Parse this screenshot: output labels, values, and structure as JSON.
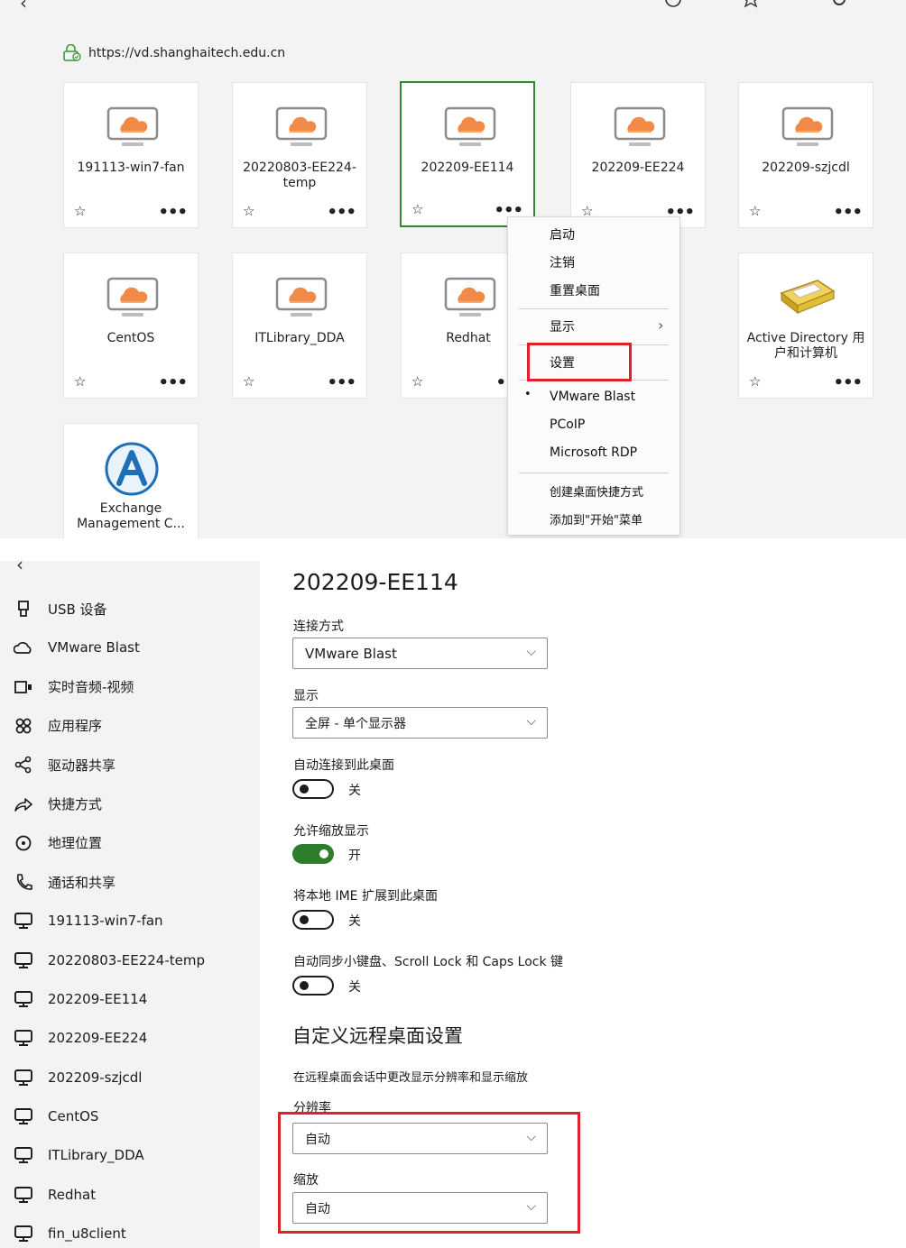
{
  "top": {
    "url": "https://vd.shanghaitech.edu.cn",
    "back_glyph": "‹",
    "topbar_icons": [
      "clock-icon",
      "star-icon",
      "gear-icon"
    ],
    "tiles": [
      {
        "name": "191113-win7-fan",
        "icon": "desktop-cloud-icon"
      },
      {
        "name": "20220803-EE224-temp",
        "icon": "desktop-cloud-icon"
      },
      {
        "name": "202209-EE114",
        "icon": "desktop-cloud-icon",
        "selected": true
      },
      {
        "name": "202209-EE224",
        "icon": "desktop-cloud-icon"
      },
      {
        "name": "202209-szjcdl",
        "icon": "desktop-cloud-icon"
      },
      {
        "name": "CentOS",
        "icon": "desktop-cloud-icon"
      },
      {
        "name": "ITLibrary_DDA",
        "icon": "desktop-cloud-icon"
      },
      {
        "name": "Redhat",
        "icon": "desktop-cloud-icon"
      },
      {
        "name": "Active Directory 用户和计算机",
        "icon": "address-book-icon"
      },
      {
        "name": "Exchange Management C...",
        "icon": "exchange-icon"
      }
    ],
    "context_menu": {
      "items_a": [
        "启动",
        "注销",
        "重置桌面"
      ],
      "display": "显示",
      "settings": "设置",
      "protocols": [
        "VMware Blast",
        "PCoIP",
        "Microsoft RDP"
      ],
      "selected_protocol": "VMware Blast",
      "items_b": [
        "创建桌面快捷方式",
        "添加到\"开始\"菜单"
      ]
    },
    "accent": "#2f8a2f",
    "highlight": "#e0202b"
  },
  "sidebar": {
    "back_glyph": "‹",
    "items": [
      {
        "label": "USB 设备",
        "icon": "usb-icon"
      },
      {
        "label": "VMware Blast",
        "icon": "cloud-icon"
      },
      {
        "label": "实时音频-视频",
        "icon": "webcam-icon"
      },
      {
        "label": "应用程序",
        "icon": "apps-icon"
      },
      {
        "label": "驱动器共享",
        "icon": "share-icon"
      },
      {
        "label": "快捷方式",
        "icon": "shortcut-icon"
      },
      {
        "label": "地理位置",
        "icon": "location-icon"
      },
      {
        "label": "通话和共享",
        "icon": "phone-icon"
      },
      {
        "label": "191113-win7-fan",
        "icon": "desktop-icon"
      },
      {
        "label": "20220803-EE224-temp",
        "icon": "desktop-icon"
      },
      {
        "label": "202209-EE114",
        "icon": "desktop-icon"
      },
      {
        "label": "202209-EE224",
        "icon": "desktop-icon"
      },
      {
        "label": "202209-szjcdl",
        "icon": "desktop-icon"
      },
      {
        "label": "CentOS",
        "icon": "desktop-icon"
      },
      {
        "label": "ITLibrary_DDA",
        "icon": "desktop-icon"
      },
      {
        "label": "Redhat",
        "icon": "desktop-icon"
      },
      {
        "label": "fin_u8client",
        "icon": "desktop-icon"
      }
    ]
  },
  "settings": {
    "title": "202209-EE114",
    "connection_label": "连接方式",
    "connection_value": "VMware Blast",
    "display_label": "显示",
    "display_value": "全屏 - 单个显示器",
    "auto_connect_label": "自动连接到此桌面",
    "auto_connect_state": "关",
    "allow_scaling_label": "允许缩放显示",
    "allow_scaling_state": "开",
    "ime_label": "将本地 IME 扩展到此桌面",
    "ime_state": "关",
    "sync_label": "自动同步小键盘、Scroll Lock 和 Caps Lock 键",
    "sync_state": "关",
    "custom_heading": "自定义远程桌面设置",
    "custom_desc": "在远程桌面会话中更改显示分辨率和显示缩放",
    "resolution_label": "分辨率",
    "resolution_value": "自动",
    "scale_label": "缩放",
    "scale_value": "自动",
    "toggle_on_color": "#2d7d2d"
  }
}
